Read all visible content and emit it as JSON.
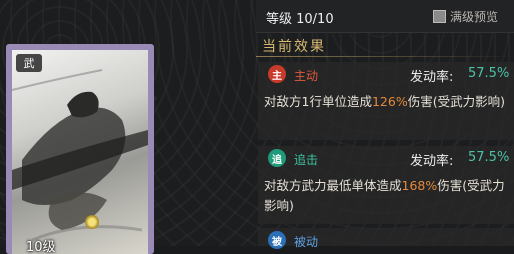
{
  "card": {
    "faction_label": "武",
    "level_label": "10级",
    "frame_color": "#9a8ab6"
  },
  "panel": {
    "level_text": "等级 10/10",
    "full_preview_label": "满级预览",
    "section_title": "当前效果"
  },
  "skills": [
    {
      "icon_char": "主",
      "icon_color": "#c83a2a",
      "type_label": "主动",
      "type_color": "#e05a3a",
      "rate_label": "发动率:",
      "rate_value": "57.5%",
      "desc_before": "对敌方1行单位造成",
      "desc_value": "126%",
      "desc_after": "伤害(受武力影响)"
    },
    {
      "icon_char": "追",
      "icon_color": "#1f9a7a",
      "type_label": "追击",
      "type_color": "#3fc4a0",
      "rate_label": "发动率:",
      "rate_value": "57.5%",
      "desc_before": "对敌方武力最低单体造成",
      "desc_value": "168%",
      "desc_after": "伤害(受武力影响)"
    },
    {
      "icon_char": "被",
      "icon_color": "#2a6fb8",
      "type_label": "被动",
      "type_color": "#5ea0e0"
    }
  ]
}
